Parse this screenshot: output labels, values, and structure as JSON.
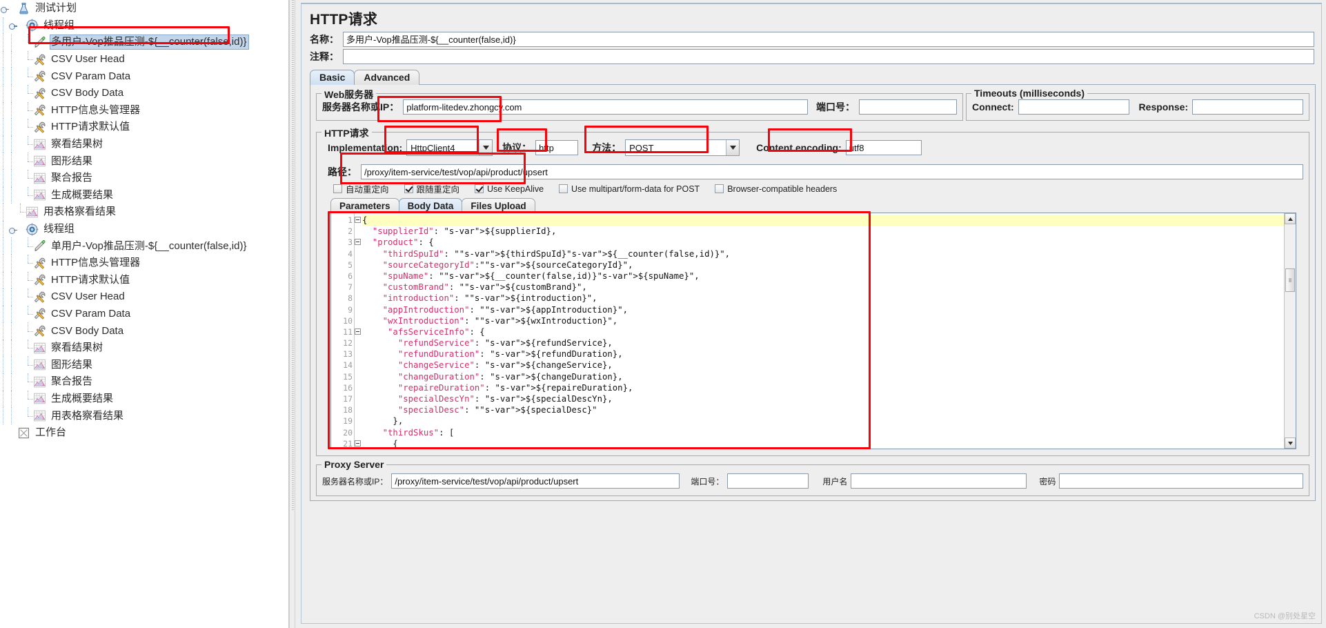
{
  "tree": {
    "items": [
      {
        "label": "测试计划",
        "icon": "test-plan-icon",
        "depth": 0,
        "toggle": true,
        "selected": false
      },
      {
        "label": "线程组",
        "icon": "thread-group-icon",
        "depth": 1,
        "toggle": true,
        "selected": false
      },
      {
        "label": "多用户-Vop推品压测-${__counter(false,id)}",
        "icon": "http-sampler-icon",
        "depth": 2,
        "toggle": false,
        "selected": true
      },
      {
        "label": "CSV User Head",
        "icon": "csv-config-icon",
        "depth": 2,
        "toggle": false,
        "selected": false
      },
      {
        "label": "CSV Param Data",
        "icon": "csv-config-icon",
        "depth": 2,
        "toggle": false,
        "selected": false
      },
      {
        "label": "CSV Body Data",
        "icon": "csv-config-icon",
        "depth": 2,
        "toggle": false,
        "selected": false
      },
      {
        "label": "HTTP信息头管理器",
        "icon": "csv-config-icon",
        "depth": 2,
        "toggle": false,
        "selected": false
      },
      {
        "label": "HTTP请求默认值",
        "icon": "csv-config-icon",
        "depth": 2,
        "toggle": false,
        "selected": false
      },
      {
        "label": "察看结果树",
        "icon": "listener-icon",
        "depth": 2,
        "toggle": false,
        "selected": false
      },
      {
        "label": "图形结果",
        "icon": "listener-icon",
        "depth": 2,
        "toggle": false,
        "selected": false
      },
      {
        "label": "聚合报告",
        "icon": "listener-icon",
        "depth": 2,
        "toggle": false,
        "selected": false
      },
      {
        "label": "生成概要结果",
        "icon": "listener-icon",
        "depth": 2,
        "toggle": false,
        "selected": false
      },
      {
        "label": "用表格察看结果",
        "icon": "listener-icon",
        "depth": 1,
        "toggle": false,
        "selected": false
      },
      {
        "label": "线程组",
        "icon": "thread-group-icon",
        "depth": 1,
        "toggle": true,
        "selected": false
      },
      {
        "label": "单用户-Vop推品压测-${__counter(false,id)}",
        "icon": "http-sampler-icon",
        "depth": 2,
        "toggle": false,
        "selected": false
      },
      {
        "label": "HTTP信息头管理器",
        "icon": "csv-config-icon",
        "depth": 2,
        "toggle": false,
        "selected": false
      },
      {
        "label": "HTTP请求默认值",
        "icon": "csv-config-icon",
        "depth": 2,
        "toggle": false,
        "selected": false
      },
      {
        "label": "CSV User Head",
        "icon": "csv-config-icon",
        "depth": 2,
        "toggle": false,
        "selected": false
      },
      {
        "label": "CSV Param Data",
        "icon": "csv-config-icon",
        "depth": 2,
        "toggle": false,
        "selected": false
      },
      {
        "label": "CSV Body Data",
        "icon": "csv-config-icon",
        "depth": 2,
        "toggle": false,
        "selected": false
      },
      {
        "label": "察看结果树",
        "icon": "listener-icon",
        "depth": 2,
        "toggle": false,
        "selected": false
      },
      {
        "label": "图形结果",
        "icon": "listener-icon",
        "depth": 2,
        "toggle": false,
        "selected": false
      },
      {
        "label": "聚合报告",
        "icon": "listener-icon",
        "depth": 2,
        "toggle": false,
        "selected": false
      },
      {
        "label": "生成概要结果",
        "icon": "listener-icon",
        "depth": 2,
        "toggle": false,
        "selected": false
      },
      {
        "label": "用表格察看结果",
        "icon": "listener-icon",
        "depth": 2,
        "toggle": false,
        "selected": false
      },
      {
        "label": "工作台",
        "icon": "workbench-icon",
        "depth": 0,
        "toggle": false,
        "selected": false
      }
    ]
  },
  "panel": {
    "title": "HTTP请求",
    "name_label": "名称：",
    "name_value": "多用户-Vop推品压测-${__counter(false,id)}",
    "comment_label": "注释：",
    "comment_value": "",
    "tabs": [
      {
        "label": "Basic",
        "active": true
      },
      {
        "label": "Advanced",
        "active": false
      }
    ]
  },
  "web_server": {
    "legend": "Web服务器",
    "host_label": "服务器名称或IP：",
    "host_value": "platform-litedev.zhongcy.com",
    "port_label": "端口号：",
    "port_value": ""
  },
  "timeouts": {
    "legend": "Timeouts (milliseconds)",
    "connect_label": "Connect:",
    "connect_value": "",
    "response_label": "Response:",
    "response_value": ""
  },
  "http_request": {
    "legend": "HTTP请求",
    "implementation_label": "Implementation:",
    "implementation_value": "HttpClient4",
    "protocol_label": "协议：",
    "protocol_value": "http",
    "method_label": "方法：",
    "method_value": "POST",
    "encoding_label": "Content encoding:",
    "encoding_value": "utf8",
    "path_label": "路径：",
    "path_value": "/proxy/item-service/test/vop/api/product/upsert",
    "checkboxes": [
      {
        "label": "自动重定向",
        "checked": false
      },
      {
        "label": "跟随重定向",
        "checked": true
      },
      {
        "label": "Use KeepAlive",
        "checked": true
      },
      {
        "label": "Use multipart/form-data for POST",
        "checked": false
      },
      {
        "label": "Browser-compatible headers",
        "checked": false
      }
    ],
    "inner_tabs": [
      {
        "label": "Parameters",
        "active": false
      },
      {
        "label": "Body Data",
        "active": true
      },
      {
        "label": "Files Upload",
        "active": false
      }
    ]
  },
  "body_data": {
    "lines": [
      {
        "n": 1,
        "fold": true,
        "text": "{",
        "hl": true
      },
      {
        "n": 2,
        "fold": false,
        "text": "  \"supplierId\": ${supplierId},",
        "hl": false
      },
      {
        "n": 3,
        "fold": true,
        "text": "  \"product\": {",
        "hl": false
      },
      {
        "n": 4,
        "fold": false,
        "text": "    \"thirdSpuId\": \"${thirdSpuId}${__counter(false,id)}\",",
        "hl": false
      },
      {
        "n": 5,
        "fold": false,
        "text": "    \"sourceCategoryId\":\"${sourceCategoryId}\",",
        "hl": false
      },
      {
        "n": 6,
        "fold": false,
        "text": "    \"spuName\": \"${__counter(false,id)}${spuName}\",",
        "hl": false
      },
      {
        "n": 7,
        "fold": false,
        "text": "    \"customBrand\": \"${customBrand}\",",
        "hl": false
      },
      {
        "n": 8,
        "fold": false,
        "text": "    \"introduction\": \"${introduction}\",",
        "hl": false
      },
      {
        "n": 9,
        "fold": false,
        "text": "    \"appIntroduction\": \"${appIntroduction}\",",
        "hl": false
      },
      {
        "n": 10,
        "fold": false,
        "text": "    \"wxIntroduction\": \"${wxIntroduction}\",",
        "hl": false
      },
      {
        "n": 11,
        "fold": true,
        "text": "     \"afsServiceInfo\": {",
        "hl": false
      },
      {
        "n": 12,
        "fold": false,
        "text": "       \"refundService\": ${refundService},",
        "hl": false
      },
      {
        "n": 13,
        "fold": false,
        "text": "       \"refundDuration\": ${refundDuration},",
        "hl": false
      },
      {
        "n": 14,
        "fold": false,
        "text": "       \"changeService\": ${changeService},",
        "hl": false
      },
      {
        "n": 15,
        "fold": false,
        "text": "       \"changeDuration\": ${changeDuration},",
        "hl": false
      },
      {
        "n": 16,
        "fold": false,
        "text": "       \"repaireDuration\": ${repaireDuration},",
        "hl": false
      },
      {
        "n": 17,
        "fold": false,
        "text": "       \"specialDescYn\": ${specialDescYn},",
        "hl": false
      },
      {
        "n": 18,
        "fold": false,
        "text": "       \"specialDesc\": \"${specialDesc}\"",
        "hl": false
      },
      {
        "n": 19,
        "fold": false,
        "text": "      },",
        "hl": false
      },
      {
        "n": 20,
        "fold": false,
        "text": "    \"thirdSkus\": [",
        "hl": false
      },
      {
        "n": 21,
        "fold": true,
        "text": "      {",
        "hl": false
      }
    ]
  },
  "proxy_server": {
    "legend": "Proxy Server",
    "host_label": "服务器名称或IP：",
    "host_value": "/proxy/item-service/test/vop/api/product/upsert",
    "port_label": "端口号：",
    "port_value": "",
    "user_label": "用户名",
    "user_value": "",
    "pass_label": "密码",
    "pass_value": ""
  },
  "watermark": "CSDN @别处星空",
  "colors": {
    "highlight_red": "#f4030b",
    "selection_blue": "#c3d5ea",
    "tab_active": "#cfe0f2",
    "code_highlight": "#ffffc0",
    "string_pink": "#d62d6b"
  }
}
